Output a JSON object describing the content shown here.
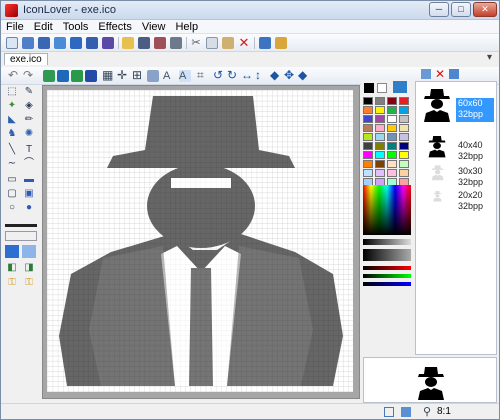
{
  "window": {
    "title": "IconLover - exe.ico"
  },
  "window_controls": {
    "minimize": "─",
    "maximize": "□",
    "close": "✕"
  },
  "menu": {
    "items": [
      "File",
      "Edit",
      "Tools",
      "Effects",
      "View",
      "Help"
    ]
  },
  "tab": {
    "label": "exe.ico",
    "close": "▾"
  },
  "sizes": [
    {
      "dim": "60x60",
      "bpp": "32bpp"
    },
    {
      "dim": "40x40",
      "bpp": "32bpp"
    },
    {
      "dim": "30x30",
      "bpp": "32bpp"
    },
    {
      "dim": "20x20",
      "bpp": "32bpp"
    }
  ],
  "status": {
    "zoom": "8:1"
  },
  "colors": {
    "accent": "#3399ff",
    "canvas_bg": "#a6a6a6"
  }
}
